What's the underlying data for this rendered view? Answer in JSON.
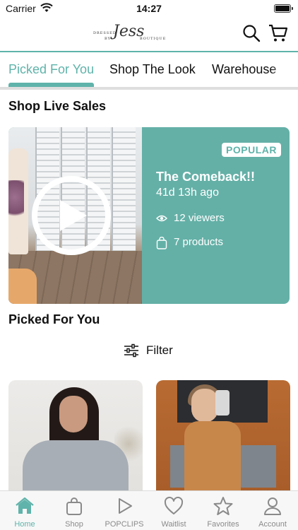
{
  "status_bar": {
    "carrier": "Carrier",
    "time": "14:27"
  },
  "header": {
    "logo": {
      "line1": "DRESSED",
      "line2": "BY",
      "main": "Jess",
      "tag": "BOUTIQUE"
    }
  },
  "tabs": [
    {
      "label": "Picked For You",
      "active": true
    },
    {
      "label": "Shop The Look",
      "active": false
    },
    {
      "label": "Warehouse",
      "active": false
    }
  ],
  "live_section": {
    "title": "Shop Live Sales",
    "card": {
      "badge": "POPULAR",
      "title": "The Comeback!!",
      "time_ago": "41d 13h ago",
      "viewers": "12 viewers",
      "products": "7 products"
    }
  },
  "picked_section": {
    "title": "Picked For You",
    "filter_label": "Filter"
  },
  "bottom_nav": [
    {
      "label": "Home",
      "icon": "home-icon",
      "active": true
    },
    {
      "label": "Shop",
      "icon": "bag-icon",
      "active": false
    },
    {
      "label": "POPCLIPS",
      "icon": "play-icon",
      "active": false
    },
    {
      "label": "Waitlist",
      "icon": "heart-icon",
      "active": false
    },
    {
      "label": "Favorites",
      "icon": "star-icon",
      "active": false
    },
    {
      "label": "Account",
      "icon": "person-icon",
      "active": false
    }
  ],
  "colors": {
    "accent": "#5fb3aa",
    "inactive": "#8a8a8a"
  }
}
